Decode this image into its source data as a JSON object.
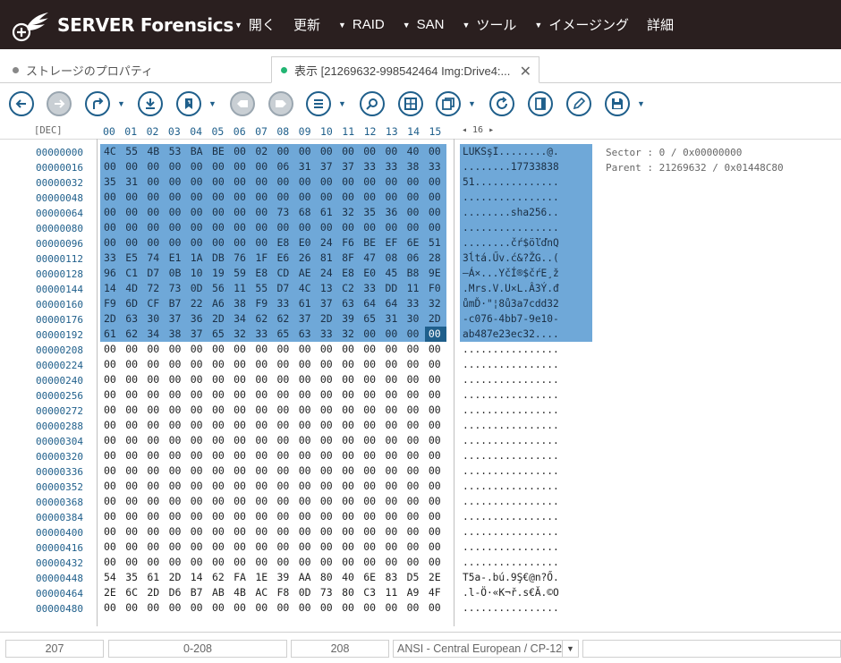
{
  "app": {
    "logo_text": "SERVER Forensics",
    "accent_color": "#1f5f8b",
    "selection_color": "#6fa8d8"
  },
  "menu": [
    {
      "label": "開く",
      "has_caret": true
    },
    {
      "label": "更新",
      "has_caret": false
    },
    {
      "label": "RAID",
      "has_caret": true
    },
    {
      "label": "SAN",
      "has_caret": true
    },
    {
      "label": "ツール",
      "has_caret": true
    },
    {
      "label": "イメージング",
      "has_caret": true
    },
    {
      "label": "詳細",
      "has_caret": false
    }
  ],
  "tabs": [
    {
      "label": "ストレージのプロパティ",
      "active": false
    },
    {
      "label": "表示 [21269632-998542464 Img:Drive4:...",
      "active": true
    }
  ],
  "toolbar": {
    "icons": [
      "back-icon",
      "forward-icon",
      "jump-icon",
      "download-icon",
      "bookmark-icon",
      "prev-bookmark-icon",
      "next-bookmark-icon",
      "list-icon",
      "search-icon",
      "grid-icon",
      "copy-icon",
      "refresh-icon",
      "panel-icon",
      "edit-icon",
      "save-icon"
    ]
  },
  "hex_view": {
    "dec_label": "[DEC]",
    "columns": [
      "00",
      "01",
      "02",
      "03",
      "04",
      "05",
      "06",
      "07",
      "08",
      "09",
      "10",
      "11",
      "12",
      "13",
      "14",
      "15"
    ],
    "width_control": "◂ 16 ▸",
    "offsets": [
      "00000000",
      "00000016",
      "00000032",
      "00000048",
      "00000064",
      "00000080",
      "00000096",
      "00000112",
      "00000128",
      "00000144",
      "00000160",
      "00000176",
      "00000192",
      "00000208",
      "00000224",
      "00000240",
      "00000256",
      "00000272",
      "00000288",
      "00000304",
      "00000320",
      "00000336",
      "00000352",
      "00000368",
      "00000384",
      "00000400",
      "00000416",
      "00000432",
      "00000448",
      "00000464",
      "00000480"
    ],
    "rows": [
      "4C 55 4B 53 BA BE 00 02 00 00 00 00 00 00 40 00",
      "00 00 00 00 00 00 00 00 06 31 37 37 33 33 38 33 38",
      "35 31 00 00 00 00 00 00 00 00 00 00 00 00 00 00",
      "00 00 00 00 00 00 00 00 00 00 00 00 00 00 00 00",
      "00 00 00 00 00 00 00 00 73 68 61 32 35 36 00 00",
      "00 00 00 00 00 00 00 00 00 00 00 00 00 00 00 00",
      "00 00 00 00 00 00 00 00 E8 E0 24 F6 BE EF 6E 51",
      "33 E5 74 E1 1A DB 76 1F E6 26 81 8F 47 08 06 28",
      "96 C1 D7 0B 10 19 59 E8 CD AE 24 E8 E0 45 B8 9E",
      "14 4D 72 73 0D 56 11 55 D7 4C 13 C2 33 DD 11 F0",
      "F9 6D CF B7 22 A6 38 F9 33 61 37 63 64 64 33 32",
      "2D 63 30 37 36 2D 34 62 62 37 2D 39 65 31 30 2D",
      "61 62 34 38 37 65 32 33 65 63 33 32 00 00 00 00",
      "00 00 00 00 00 00 00 00 00 00 00 00 00 00 00 00",
      "00 00 00 00 00 00 00 00 00 00 00 00 00 00 00 00",
      "00 00 00 00 00 00 00 00 00 00 00 00 00 00 00 00",
      "00 00 00 00 00 00 00 00 00 00 00 00 00 00 00 00",
      "00 00 00 00 00 00 00 00 00 00 00 00 00 00 00 00",
      "00 00 00 00 00 00 00 00 00 00 00 00 00 00 00 00",
      "00 00 00 00 00 00 00 00 00 00 00 00 00 00 00 00",
      "00 00 00 00 00 00 00 00 00 00 00 00 00 00 00 00",
      "00 00 00 00 00 00 00 00 00 00 00 00 00 00 00 00",
      "00 00 00 00 00 00 00 00 00 00 00 00 00 00 00 00",
      "00 00 00 00 00 00 00 00 00 00 00 00 00 00 00 00",
      "00 00 00 00 00 00 00 00 00 00 00 00 00 00 00 00",
      "00 00 00 00 00 00 00 00 00 00 00 00 00 00 00 00",
      "00 00 00 00 00 00 00 00 00 00 00 00 00 00 00 00",
      "00 00 00 00 00 00 00 00 00 00 00 00 00 00 00 00",
      "54 35 61 2D 14 62 FA 1E 39 AA 80 40 6E 83 D5 2E",
      "2E 6C 2D D6 B7 AB 4B AC F8 0D 73 80 C3 11 A9 4F",
      "00 00 00 00 00 00 00 00 00 00 00 00 00 00 00 00"
    ],
    "ascii": [
      "LUKSşI........@.",
      "........17733838",
      "51..............",
      "................",
      "........sha256..",
      "................",
      "........čŕ$öľďnQ",
      "3ĺtá.Űv.ć&?ŽG..(",
      "–Á×...YčÍ®$čŕE¸ž",
      ".Mrs.V.U×L.Â3Ý.đ",
      "ůmĎ·\"¦8ů3a7cdd32",
      "-c076-4bb7-9e10-",
      "ab487e23ec32....",
      "................",
      "................",
      "................",
      "................",
      "................",
      "................",
      "................",
      "................",
      "................",
      "................",
      "................",
      "................",
      "................",
      "................",
      "................",
      "T5a-.bú.9Ş€@n?Ő.",
      ".l-Ö·«K¬ř.s€Ă.©O",
      "................"
    ],
    "selected_rows": 13
  },
  "info": {
    "sector": "Sector : 0 / 0x00000000",
    "parent": "Parent : 21269632 / 0x01448C80"
  },
  "statusbar": {
    "position": "207",
    "range": "0-208",
    "length": "208",
    "encoding": "ANSI - Central European / CP-12"
  }
}
